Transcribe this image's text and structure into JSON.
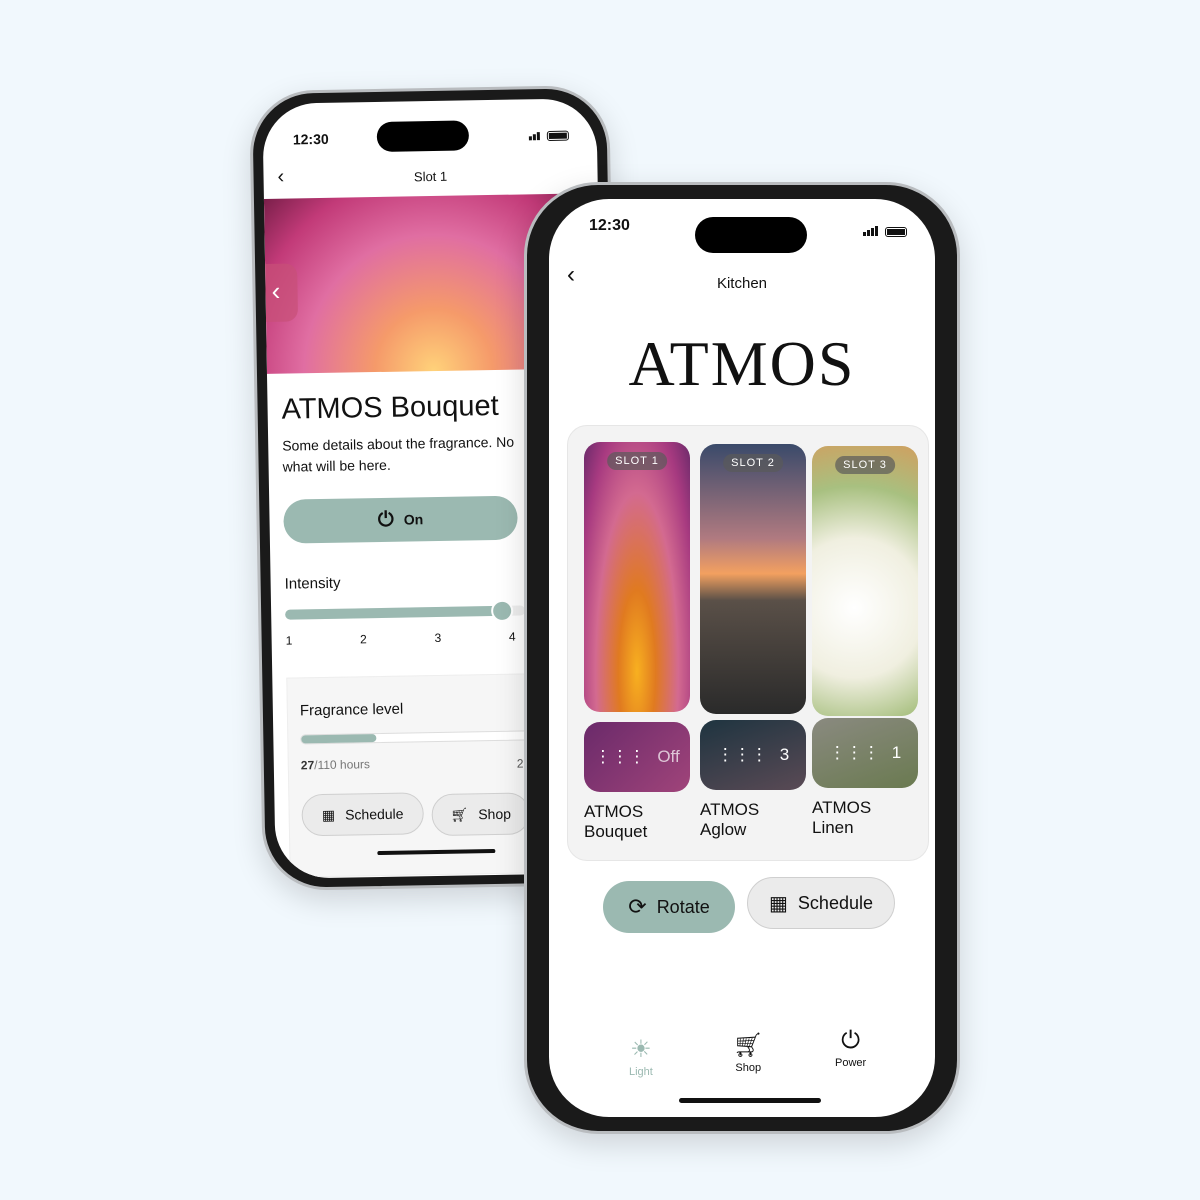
{
  "back_phone": {
    "time": "12:30",
    "title": "Slot 1",
    "product_name": "ATMOS Bouquet",
    "description_line1": "Some details about the fragrance. No",
    "description_line2": "what will be here.",
    "power_label": "On",
    "intensity_label": "Intensity",
    "intensity_ticks": [
      "1",
      "2",
      "3",
      "4"
    ],
    "intensity_value": 4,
    "fragrance_level_label": "Fragrance level",
    "fragrance_used": "27",
    "fragrance_total": "/110 hours",
    "fragrance_fraction": 0.25,
    "fragrance_right": "25",
    "schedule_label": "Schedule",
    "shop_label": "Shop"
  },
  "front_phone": {
    "time": "12:30",
    "title": "Kitchen",
    "logo": "ATMOS",
    "slots": [
      {
        "badge": "SLOT 1",
        "status": "Off",
        "name1": "ATMOS",
        "name2": "Bouquet"
      },
      {
        "badge": "SLOT 2",
        "status": "3",
        "name1": "ATMOS",
        "name2": "Aglow"
      },
      {
        "badge": "SLOT 3",
        "status": "1",
        "name1": "ATMOS",
        "name2": "Linen"
      }
    ],
    "rotate_label": "Rotate",
    "schedule_label": "Schedule",
    "nav": [
      {
        "label": "Light",
        "icon": "sun-icon"
      },
      {
        "label": "Shop",
        "icon": "cart-icon"
      },
      {
        "label": "Power",
        "icon": "power-icon"
      }
    ]
  },
  "colors": {
    "accent": "#9bb9b1",
    "background": "#f1f8fd"
  }
}
